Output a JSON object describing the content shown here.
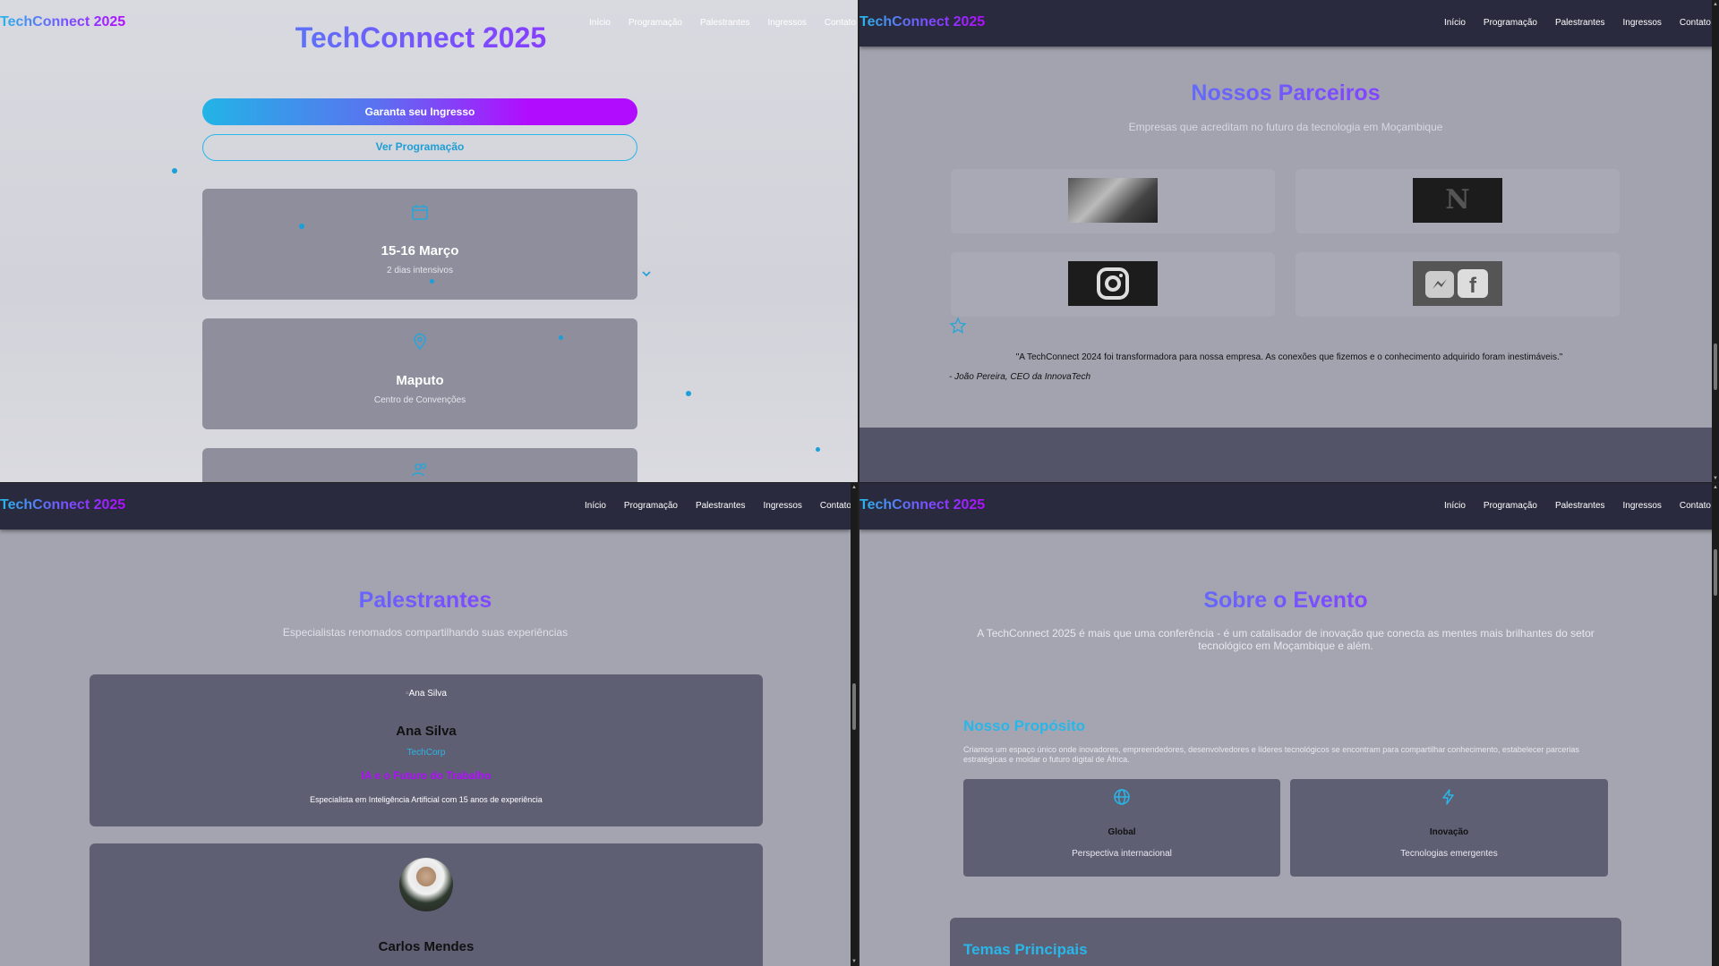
{
  "brand": "TechConnect 2025",
  "nav": [
    "Início",
    "Programação",
    "Palestrantes",
    "Ingressos",
    "Contato"
  ],
  "hero": {
    "title": "TechConnect 2025",
    "cta_primary": "Garanta seu Ingresso",
    "cta_secondary": "Ver Programação",
    "cards": [
      {
        "icon": "calendar-icon",
        "title": "15-16 Março",
        "subtitle": "2 dias intensivos"
      },
      {
        "icon": "map-pin-icon",
        "title": "Maputo",
        "subtitle": "Centro de Convenções"
      }
    ]
  },
  "partners": {
    "title": "Nossos Parceiros",
    "subtitle": "Empresas que acreditam no futuro da tecnologia em Moçambique",
    "testimonial": "\"A TechConnect 2024 foi transformadora para nossa empresa. As conexões que fizemos e o conhecimento adquirido foram inestimáveis.\"",
    "author": "- João Pereira, CEO da InnovaTech"
  },
  "speakers": {
    "title": "Palestrantes",
    "subtitle": "Especialistas renomados compartilhando suas experiências",
    "list": [
      {
        "img_alt": "Ana Silva",
        "name": "Ana Silva",
        "company": "TechCorp",
        "talk": "IA e o Futuro do Trabalho",
        "bio": "Especialista em Inteligência Artificial com 15 anos de experiência"
      },
      {
        "name": "Carlos Mendes"
      }
    ]
  },
  "about": {
    "title": "Sobre o Evento",
    "intro": "A TechConnect 2025 é mais que uma conferência - é um catalisador de inovação que conecta as mentes mais brilhantes do setor tecnológico em Moçambique e além.",
    "purpose_title": "Nosso Propósito",
    "purpose_text": "Criamos um espaço único onde inovadores, empreendedores, desenvolvedores e líderes tecnológicos se encontram para compartilhar conhecimento, estabelecer parcerias estratégicas e moldar o futuro digital de África.",
    "features": [
      {
        "icon": "globe-icon",
        "title": "Global",
        "subtitle": "Perspectiva internacional"
      },
      {
        "icon": "lightning-icon",
        "title": "Inovação",
        "subtitle": "Tecnologias emergentes"
      }
    ],
    "themes_title": "Temas Principais"
  },
  "colors": {
    "accent_blue": "#29b6e8",
    "accent_purple": "#b20cff",
    "navbar": "#2a2a3e"
  }
}
